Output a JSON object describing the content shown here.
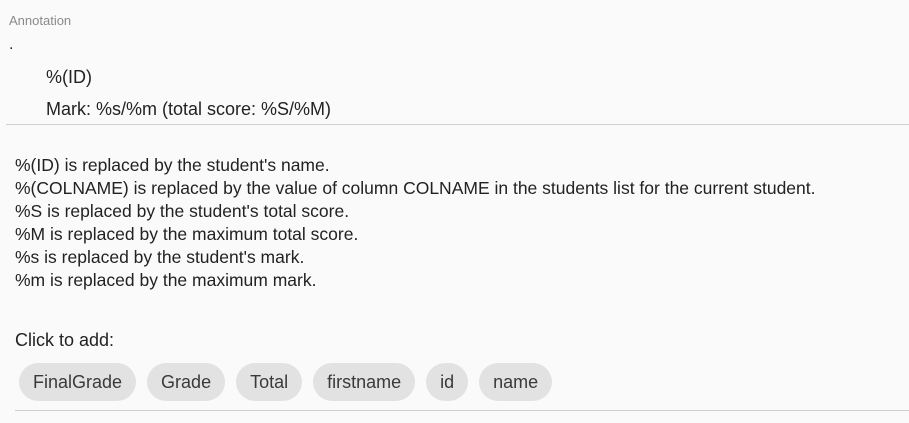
{
  "annotation": {
    "label": "Annotation",
    "dot": ".",
    "lines": [
      "%(ID)",
      "Mark: %s/%m (total score: %S/%M)"
    ]
  },
  "help": {
    "lines": [
      "%(ID) is replaced by the student's name.",
      "%(COLNAME) is replaced by the value of column COLNAME in the students list for the current student.",
      "%S is replaced by the student's total score.",
      "%M is replaced by the maximum total score.",
      "%s is replaced by the student's mark.",
      "%m is replaced by the maximum mark."
    ]
  },
  "add": {
    "label": "Click to add:",
    "chips": [
      "FinalGrade",
      "Grade",
      "Total",
      "firstname",
      "id",
      "name"
    ]
  }
}
